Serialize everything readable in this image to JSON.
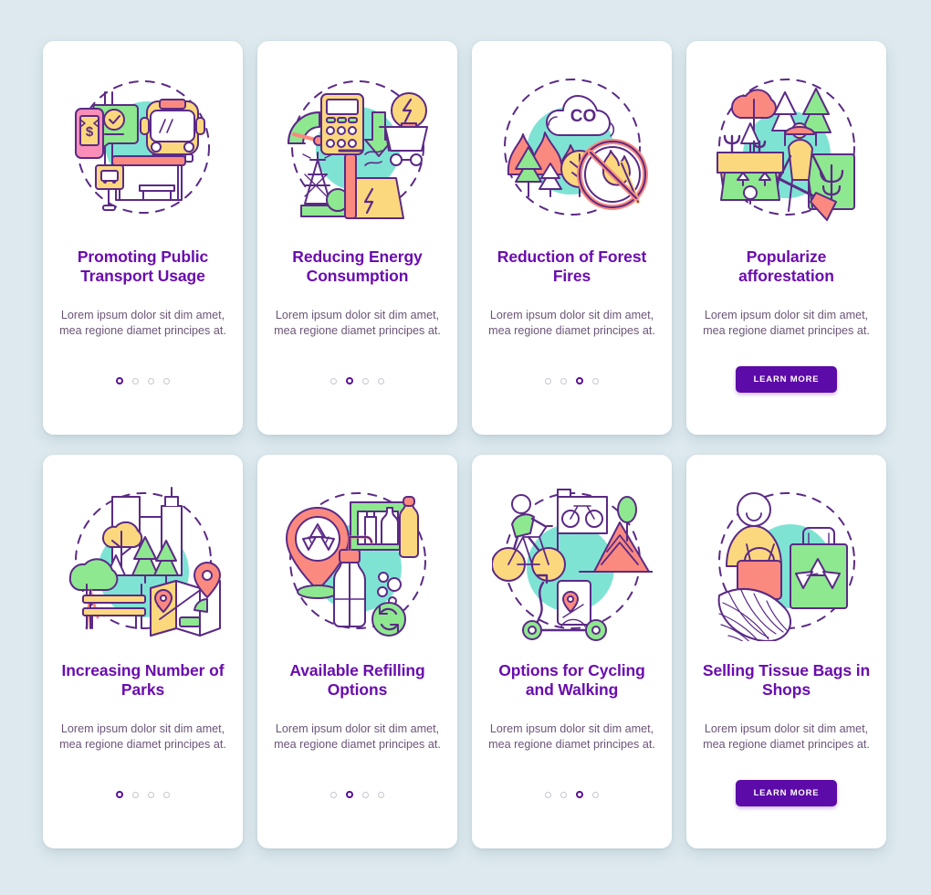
{
  "theme": {
    "background": "#dde9ee",
    "card_background": "#ffffff",
    "title_color": "#6a0dad",
    "body_color": "#6c5578",
    "accent_purple": "#5c0aa8",
    "mint": "#7fe3d4",
    "green": "#8ee88f",
    "yellow": "#fbd87e",
    "coral": "#fa8a7f",
    "pink": "#f98fb8",
    "outline": "#5b2a86"
  },
  "body_text": "Lorem ipsum dolor sit dim amet, mea regione diamet principes at.",
  "learn_more_label": "LEARN MORE",
  "cards": [
    {
      "id": "promoting-public-transport-usage",
      "title": "Promoting Public Transport Usage",
      "body": "Lorem ipsum dolor sit dim amet, mea regione diamet principes at.",
      "illustration": "public-transport-illustration",
      "footer_type": "dots",
      "dots_total": 4,
      "dots_active_index": 0
    },
    {
      "id": "reducing-energy-consumption",
      "title": "Reducing Energy Consumption",
      "body": "Lorem ipsum dolor sit dim amet, mea regione diamet principes at.",
      "illustration": "energy-consumption-illustration",
      "footer_type": "dots",
      "dots_total": 4,
      "dots_active_index": 1
    },
    {
      "id": "reduction-of-forest-fires",
      "title": "Reduction of Forest Fires",
      "body": "Lorem ipsum dolor sit dim amet, mea regione diamet principes at.",
      "illustration": "forest-fires-illustration",
      "footer_type": "dots",
      "dots_total": 4,
      "dots_active_index": 2
    },
    {
      "id": "popularize-afforestation",
      "title": "Popularize afforestation",
      "body": "Lorem ipsum dolor sit dim amet, mea regione diamet principes at.",
      "illustration": "afforestation-illustration",
      "footer_type": "button",
      "button_label": "LEARN MORE"
    },
    {
      "id": "increasing-number-of-parks",
      "title": "Increasing Number of Parks",
      "body": "Lorem ipsum dolor sit dim amet, mea regione diamet principes at.",
      "illustration": "city-parks-illustration",
      "footer_type": "dots",
      "dots_total": 4,
      "dots_active_index": 0
    },
    {
      "id": "available-refilling-options",
      "title": "Available Refilling Options",
      "body": "Lorem ipsum dolor sit dim amet, mea regione diamet principes at.",
      "illustration": "refilling-options-illustration",
      "footer_type": "dots",
      "dots_total": 4,
      "dots_active_index": 1
    },
    {
      "id": "options-for-cycling-and-walking",
      "title": "Options for Cycling and Walking",
      "body": "Lorem ipsum dolor sit dim amet, mea regione diamet principes at.",
      "illustration": "cycling-walking-illustration",
      "footer_type": "dots",
      "dots_total": 4,
      "dots_active_index": 2
    },
    {
      "id": "selling-tissue-bags-in-shops",
      "title": "Selling Tissue Bags in Shops",
      "body": "Lorem ipsum dolor sit dim amet, mea regione diamet principes at.",
      "illustration": "tissue-bags-illustration",
      "footer_type": "button",
      "button_label": "LEARN MORE"
    }
  ]
}
